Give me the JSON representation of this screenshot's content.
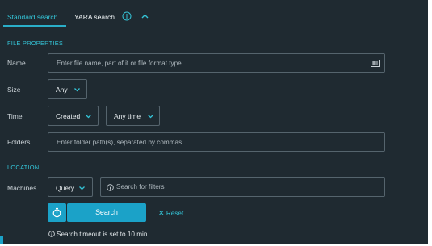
{
  "tabs": {
    "standard": "Standard search",
    "yara": "YARA search"
  },
  "file_properties": {
    "title": "FILE PROPERTIES",
    "name": {
      "label": "Name",
      "placeholder": "Enter file name, part of it or file format type"
    },
    "size": {
      "label": "Size",
      "value": "Any"
    },
    "time": {
      "label": "Time",
      "type_value": "Created",
      "range_value": "Any time"
    },
    "folders": {
      "label": "Folders",
      "placeholder": "Enter folder path(s), separated by commas"
    }
  },
  "location": {
    "title": "LOCATION",
    "machines": {
      "label": "Machines",
      "mode_value": "Query",
      "filter_placeholder": "Search for filters"
    }
  },
  "actions": {
    "search_label": "Search",
    "reset_label": "Reset",
    "timeout_text": "Search timeout is set to 10 min"
  },
  "icons": {
    "info": "info-icon",
    "collapse": "chevron-up-icon",
    "list": "list-icon",
    "dropdown": "chevron-down-icon",
    "timer": "timer-icon",
    "reset": "close-icon"
  },
  "colors": {
    "background": "#1f2a31",
    "accent": "#34c3d6",
    "button": "#1ba2c8",
    "border": "#55646d"
  }
}
